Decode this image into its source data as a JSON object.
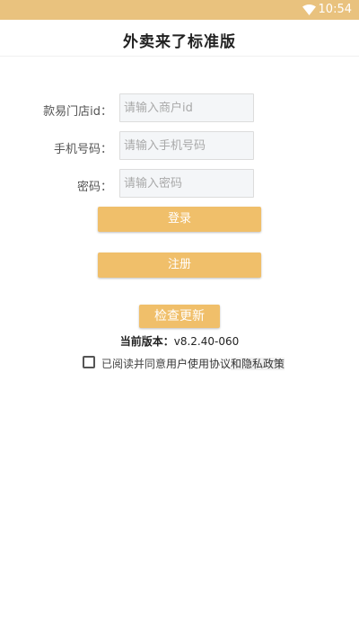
{
  "status_bar": {
    "time": "10:54",
    "icons": [
      "wifi-icon"
    ]
  },
  "colors": {
    "status_bar": "#e9c27e",
    "button": "#f0bf6a",
    "input_background": "#f4f6f8"
  },
  "header": {
    "title": "外卖来了标准版"
  },
  "form": {
    "store_id_label": "款易门店id：",
    "store_id_placeholder": "请输入商户id",
    "phone_label": "手机号码：",
    "phone_placeholder": "请输入手机号码",
    "password_label": "密码：",
    "password_placeholder": "请输入密码"
  },
  "buttons": {
    "login": "登录",
    "register": "注册",
    "check_update": "检查更新"
  },
  "version": {
    "label": "当前版本：",
    "value": "v8.2.40-060"
  },
  "agreement": {
    "prefix": "已阅读并同意",
    "user_agreement": "用户使用协议",
    "and": "和",
    "privacy_policy": "隐私政策",
    "checked": false
  }
}
